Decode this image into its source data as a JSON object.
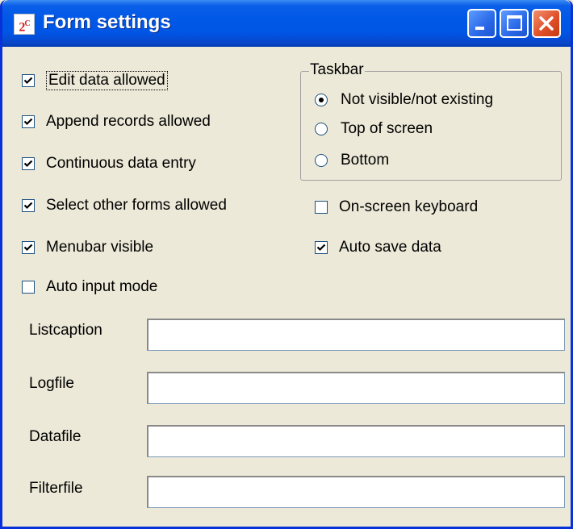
{
  "window": {
    "title": "Form settings",
    "icon_text": "2C"
  },
  "checkboxes_left": [
    {
      "label": "Edit data allowed",
      "checked": true,
      "focused": true
    },
    {
      "label": "Append records allowed",
      "checked": true
    },
    {
      "label": "Continuous data entry",
      "checked": true
    },
    {
      "label": "Select other forms allowed",
      "checked": true
    },
    {
      "label": "Menubar visible",
      "checked": true
    },
    {
      "label": "Auto input mode",
      "checked": false
    }
  ],
  "taskbar": {
    "legend": "Taskbar",
    "options": [
      {
        "label": "Not visible/not existing",
        "selected": true
      },
      {
        "label": "Top of screen",
        "selected": false
      },
      {
        "label": "Bottom",
        "selected": false
      }
    ]
  },
  "checkboxes_right": [
    {
      "label": "On-screen keyboard",
      "checked": false
    },
    {
      "label": "Auto save data",
      "checked": true
    }
  ],
  "fields": [
    {
      "label": "Listcaption",
      "value": ""
    },
    {
      "label": "Logfile",
      "value": ""
    },
    {
      "label": "Datafile",
      "value": ""
    },
    {
      "label": "Filterfile",
      "value": ""
    }
  ],
  "colors": {
    "titlebar": "#0055e5",
    "window_bg": "#ece9d8",
    "close_button": "#e0502a"
  }
}
